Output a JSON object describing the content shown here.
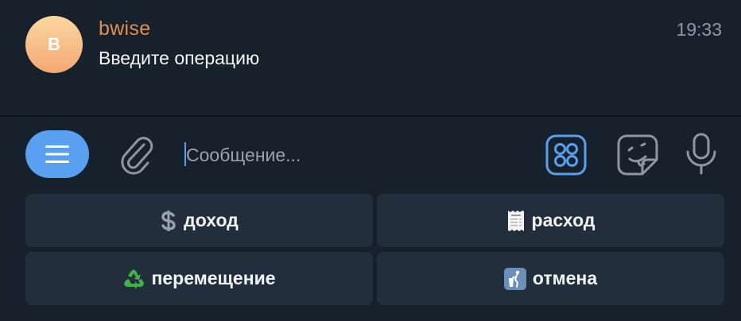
{
  "message": {
    "avatar_letter": "B",
    "sender": "bwise",
    "text": "Введите операцию",
    "time": "19:33"
  },
  "composer": {
    "placeholder": "Сообщение..."
  },
  "keyboard": {
    "buttons": [
      {
        "label": "доход",
        "icon": "dollar-icon"
      },
      {
        "label": "расход",
        "icon": "receipt-icon"
      },
      {
        "label": "перемещение",
        "icon": "recycle-icon"
      },
      {
        "label": "отмена",
        "icon": "trash-icon"
      }
    ]
  },
  "colors": {
    "background": "#17212b",
    "accent": "#5aa0f0",
    "sender_name": "#e08f52",
    "button_bg": "#232e3c"
  }
}
